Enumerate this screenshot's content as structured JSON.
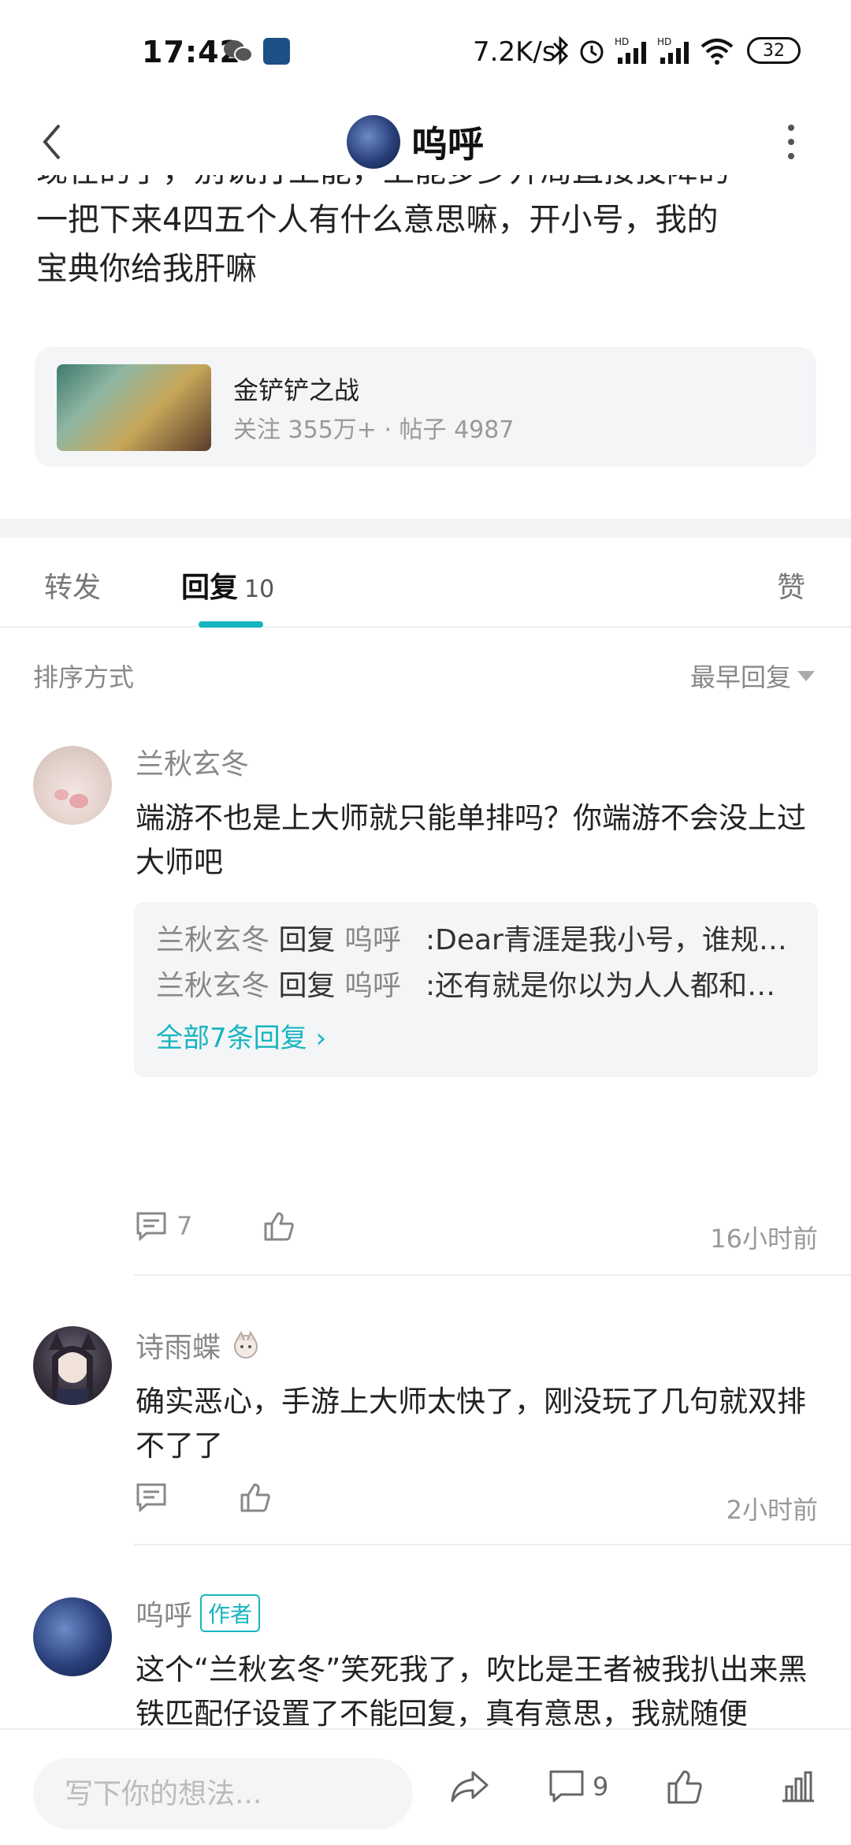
{
  "status_bar": {
    "time": "17:42",
    "net_speed": "7.2K/s",
    "battery": "32"
  },
  "header": {
    "title": "呜呼"
  },
  "post": {
    "line_partial": "现在的手，别说打上能，上能多少开局直接投降的",
    "line_1": "一把下来4四五个人有什么意思嘛，开小号，我的",
    "line_2": "宝典你给我肝嘛"
  },
  "forum": {
    "name": "金铲铲之战",
    "stats": "关注 355万+ · 帖子 4987"
  },
  "tabs": {
    "forward": "转发",
    "reply": "回复",
    "reply_count": "10",
    "like": "赞"
  },
  "sort": {
    "label": "排序方式",
    "selected": "最早回复"
  },
  "comments": [
    {
      "name": "兰秋玄冬",
      "text": "端游不也是上大师就只能单排吗？你端游不会没上过大师吧",
      "replies": [
        {
          "from": "兰秋玄冬",
          "verb": "回复",
          "to": "呜呼",
          "text": ":Dear青涯是我小号，谁规定一个人只有一个号了？😂不然为啥只有一..."
        },
        {
          "from": "兰秋玄冬",
          "verb": "回复",
          "to": "呜呼",
          "text": ":还有就是你以为人人都和你一样，把游戏当成命啊，天天泡在游戏里秀..."
        }
      ],
      "all_replies": "全部7条回复 ›",
      "reply_count": "7",
      "time": "16小时前"
    },
    {
      "name": "诗雨蝶",
      "text": "确实恶心，手游上大师太快了，刚没玩了几句就双排不了了",
      "time": "2小时前"
    },
    {
      "name": "呜呼",
      "badge": "作者",
      "text": "这个“兰秋玄冬”笑死我了，吹比是王者被我扒出来黑铁匹配仔设置了不能回复，真有意思，我就随便"
    }
  ],
  "bottom_bar": {
    "input_placeholder": "写下你的想法...",
    "comment_count": "9"
  },
  "colors": {
    "accent": "#16b5c0",
    "muted_text": "#999999",
    "card_bg": "#f4f5f7"
  }
}
